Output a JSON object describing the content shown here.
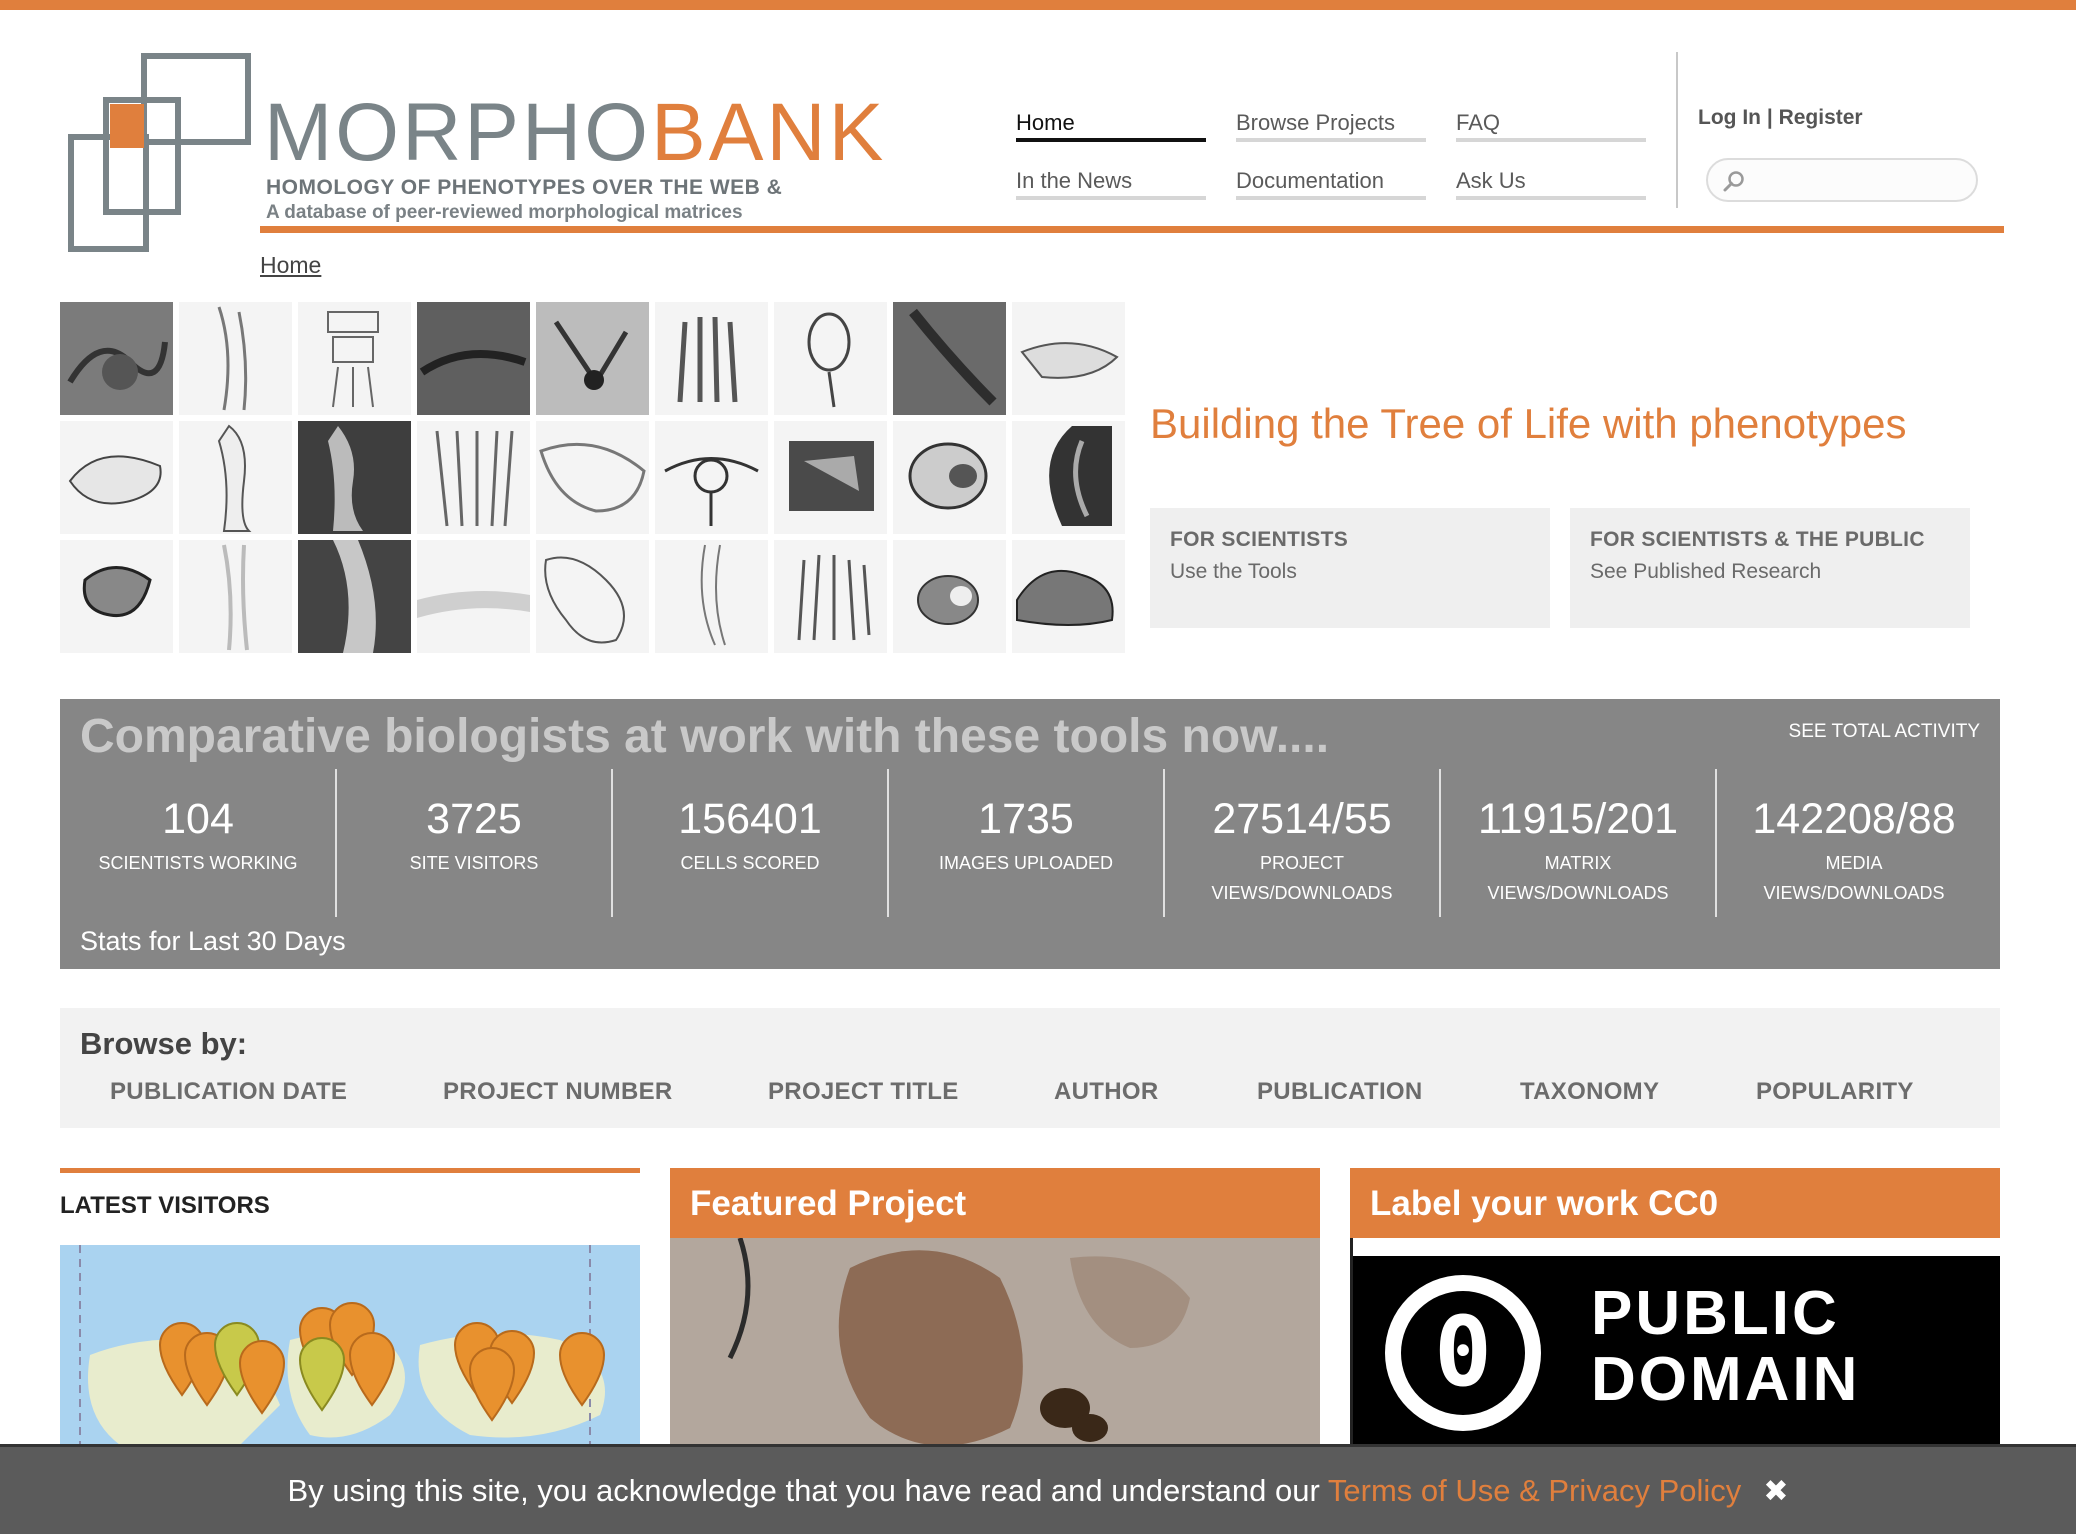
{
  "brand": {
    "name_part1": "MORPHO",
    "name_part2": "BANK",
    "tagline1": "HOMOLOGY OF PHENOTYPES OVER THE WEB &",
    "tagline2": "A database of peer-reviewed morphological matrices"
  },
  "nav": {
    "home": "Home",
    "browse_projects": "Browse Projects",
    "faq": "FAQ",
    "in_the_news": "In the News",
    "documentation": "Documentation",
    "ask_us": "Ask Us"
  },
  "account": {
    "login": "Log In",
    "separator": "|",
    "register": "Register"
  },
  "search": {
    "placeholder": ""
  },
  "breadcrumb": "Home",
  "hero": {
    "title": "Building the Tree of Life with phenotypes",
    "cta_scientists_title": "FOR SCIENTISTS",
    "cta_scientists_sub": "Use the Tools",
    "cta_public_title": "FOR SCIENTISTS & THE PUBLIC",
    "cta_public_sub": "See Published Research"
  },
  "stats": {
    "heading": "Comparative biologists at work with these tools now....",
    "see_total": "SEE TOTAL ACTIVITY",
    "footer": "Stats for Last 30 Days",
    "items": [
      {
        "value": "104",
        "label1": "SCIENTISTS WORKING",
        "label2": ""
      },
      {
        "value": "3725",
        "label1": "SITE VISITORS",
        "label2": ""
      },
      {
        "value": "156401",
        "label1": "CELLS SCORED",
        "label2": ""
      },
      {
        "value": "1735",
        "label1": "IMAGES UPLOADED",
        "label2": ""
      },
      {
        "value": "27514/55",
        "label1": "PROJECT",
        "label2": "VIEWS/DOWNLOADS"
      },
      {
        "value": "11915/201",
        "label1": "MATRIX",
        "label2": "VIEWS/DOWNLOADS"
      },
      {
        "value": "142208/88",
        "label1": "MEDIA",
        "label2": "VIEWS/DOWNLOADS"
      }
    ]
  },
  "browse": {
    "title": "Browse by:",
    "links": [
      "PUBLICATION DATE",
      "PROJECT NUMBER",
      "PROJECT TITLE",
      "AUTHOR",
      "PUBLICATION",
      "TAXONOMY",
      "POPULARITY"
    ]
  },
  "latest_visitors": {
    "title": "LATEST VISITORS"
  },
  "featured": {
    "title": "Featured Project"
  },
  "cc0": {
    "title": "Label your work CC0",
    "badge_line1": "PUBLIC",
    "badge_line2": "DOMAIN",
    "badge_symbol": "0"
  },
  "cookie": {
    "text": "By using this site, you acknowledge that you have read and understand our ",
    "link": "Terms of Use & Privacy Policy",
    "close": "✖"
  },
  "colors": {
    "accent": "#e07f3d",
    "brand_gray": "#7a8488",
    "stats_bg": "#868686",
    "panel_bg": "#f2f2f2"
  }
}
